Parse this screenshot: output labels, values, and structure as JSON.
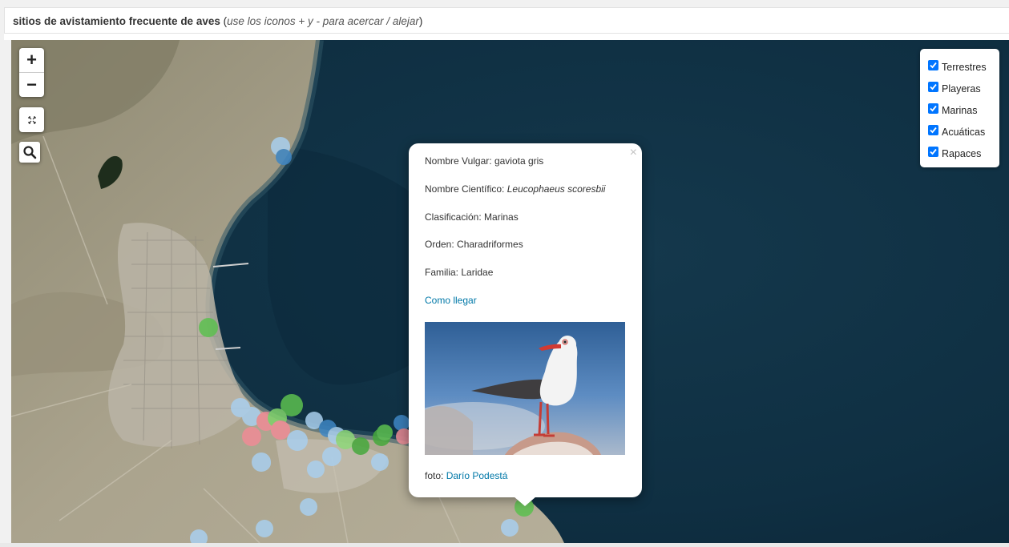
{
  "header": {
    "title": "sitios de avistamiento frecuente de aves",
    "hint": "use los iconos + y - para acercar / alejar"
  },
  "map": {
    "controls": {
      "zoom_in": "+",
      "zoom_out": "−"
    },
    "layers": [
      {
        "label": "Terrestres",
        "checked": true
      },
      {
        "label": "Playeras",
        "checked": true
      },
      {
        "label": "Marinas",
        "checked": true
      },
      {
        "label": "Acuáticas",
        "checked": true
      },
      {
        "label": "Rapaces",
        "checked": true
      }
    ],
    "popup": {
      "close": "×",
      "nombre_vulgar_label": "Nombre Vulgar:",
      "nombre_vulgar": "gaviota gris",
      "nombre_cientifico_label": "Nombre Científico:",
      "nombre_cientifico": "Leucophaeus scoresbii",
      "clasificacion_label": "Clasificación:",
      "clasificacion": "Marinas",
      "orden_label": "Orden:",
      "orden": "Charadriformes",
      "familia_label": "Familia:",
      "familia": "Laridae",
      "link": "Como llegar",
      "foto_label": "foto:",
      "foto_author": "Darío Podestá"
    },
    "colors": {
      "terrestres": "#5cc04f",
      "playeras": "#ef8c96",
      "marinas": "#a9cfee",
      "acuaticas": "#3e86c4",
      "sea": "#0e2d40",
      "land": "#a8a28e",
      "link": "#0078a8",
      "checkbox": "#0075ff"
    }
  }
}
